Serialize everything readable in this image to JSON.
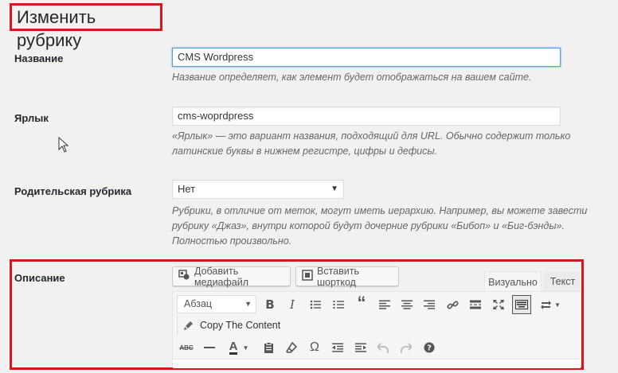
{
  "page": {
    "title": "Изменить рубрику"
  },
  "form": {
    "name": {
      "label": "Название",
      "value": "CMS Wordpress",
      "description": "Название определяет, как элемент будет отображаться на вашем сайте."
    },
    "slug": {
      "label": "Ярлык",
      "value": "cms-woprdpress",
      "description_line1": "«Ярлык» — это вариант названия, подходящий для URL. Обычно содержит только",
      "description_line2": "латинские буквы в нижнем регистре, цифры и дефисы."
    },
    "parent": {
      "label": "Родительская рубрика",
      "selected": "Нет",
      "description_line1": "Рубрики, в отличие от меток, могут иметь иерархию. Например, вы можете завести",
      "description_line2": "рубрику «Джаз», внутри которой будут дочерние рубрики «Бибоп» и «Биг-бэнды».",
      "description_line3": "Полностью произвольно."
    },
    "description": {
      "label": "Описание",
      "add_media_label": "Добавить медиафайл",
      "insert_shortcode_label": "Вставить шорткод",
      "tab_visual": "Визуально",
      "tab_text": "Текст",
      "format_selected": "Абзац",
      "copy_content_label": "Copy The Content"
    }
  },
  "accent_colors": {
    "highlight": "#d9161c",
    "focus": "#5b9dd9"
  }
}
